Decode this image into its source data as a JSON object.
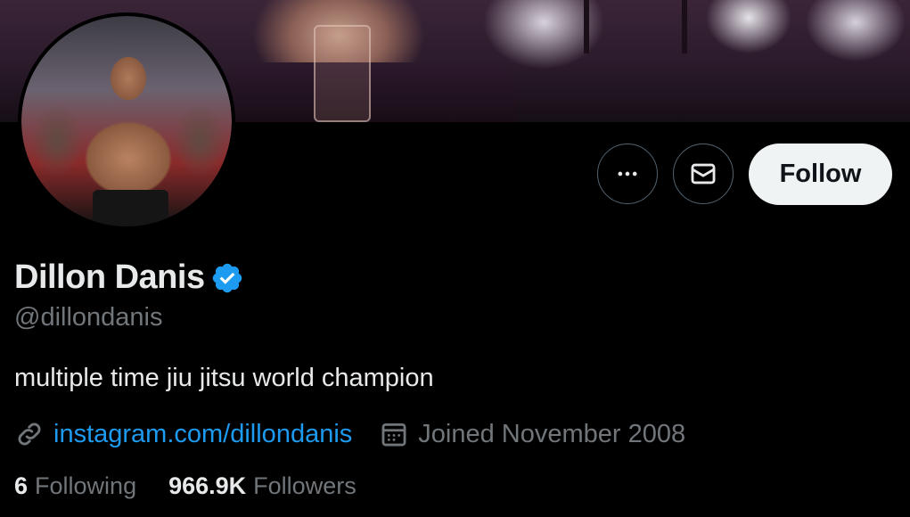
{
  "profile": {
    "name": "Dillon Danis",
    "handle": "@dillondanis",
    "bio": "multiple time jiu jitsu world champion",
    "link": "instagram.com/dillondanis",
    "joined": "Joined November 2008",
    "verified": true
  },
  "actions": {
    "follow_label": "Follow",
    "more_icon": "more-icon",
    "message_icon": "envelope-icon"
  },
  "stats": {
    "following_count": "6",
    "following_label": "Following",
    "followers_count": "966.9K",
    "followers_label": "Followers"
  },
  "colors": {
    "accent": "#1d9bf0",
    "muted": "#71767b",
    "text": "#e7e9ea",
    "follow_bg": "#eff3f4"
  }
}
